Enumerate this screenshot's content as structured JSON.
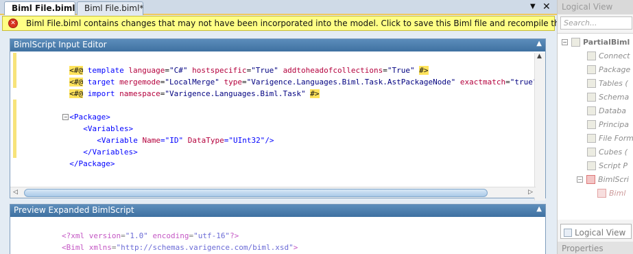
{
  "tabs": [
    {
      "label": "Biml File.biml",
      "active": true
    },
    {
      "label": "Biml File.biml*",
      "active": false
    }
  ],
  "tab_dropdown_icon": "▼",
  "tab_close_icon": "✕",
  "warning": {
    "icon": "error-icon",
    "icon_glyph": "✕",
    "text": "Biml File.biml contains changes that may not have been incorporated into the model. Click to save this Biml file and recompile the BimlScript."
  },
  "editor": {
    "title": "BimlScript Input Editor",
    "collapse_icon": "▲",
    "lines": [
      [
        "<#@",
        " ",
        "template",
        " ",
        "language",
        "=",
        "\"C#\"",
        " ",
        "hostspecific",
        "=",
        "\"True\"",
        " ",
        "addtoheadofcollections",
        "=",
        "\"True\"",
        " ",
        "#>"
      ],
      [
        "<#@",
        " ",
        "target",
        " ",
        "mergemode",
        "=",
        "\"LocalMerge\"",
        " ",
        "type",
        "=",
        "\"Varigence.Languages.Biml.Task.AstPackageNode\"",
        " ",
        "exactmatch",
        "=",
        "\"true\"",
        " ",
        "#>"
      ],
      [
        "<#@",
        " ",
        "import",
        " ",
        "namespace",
        "=",
        "\"Varigence.Languages.Biml.Task\"",
        " ",
        "#>"
      ],
      [],
      [
        "<Package>"
      ],
      [
        "<Variables>"
      ],
      [
        "<Variable",
        " ",
        "Name",
        "=",
        "\"ID\"",
        " ",
        "DataType",
        "=",
        "\"UInt32\"",
        "/>"
      ],
      [
        "</Variables>"
      ],
      [
        "</Package>"
      ]
    ]
  },
  "preview": {
    "title": "Preview Expanded BimlScript",
    "collapse_icon": "▲",
    "line1": {
      "open": "<?xml",
      "attr1": " version",
      "eq1": "=",
      "val1": "\"1.0\"",
      "attr2": " encoding",
      "eq2": "=",
      "val2": "\"utf-16\"",
      "close": "?>"
    },
    "line2": {
      "open": "<Biml",
      "attr": " xmlns",
      "eq": "=",
      "val": "\"http://schemas.varigence.com/biml.xsd\"",
      "close": ">"
    }
  },
  "logical_view": {
    "title": "Logical View",
    "search_placeholder": "Search...",
    "tree": [
      {
        "label": "PartialBiml",
        "icon": "project-icon",
        "level": 0
      },
      {
        "label": "Connect",
        "icon": "connection-icon",
        "level": 1
      },
      {
        "label": "Package",
        "icon": "package-folder-icon",
        "level": 1
      },
      {
        "label": "Tables (",
        "icon": "table-icon",
        "level": 1
      },
      {
        "label": "Schema",
        "icon": "schema-icon",
        "level": 1
      },
      {
        "label": "Databa",
        "icon": "database-icon",
        "level": 1
      },
      {
        "label": "Principa",
        "icon": "principal-icon",
        "level": 1
      },
      {
        "label": "File Form",
        "icon": "file-format-icon",
        "level": 1
      },
      {
        "label": "Cubes (",
        "icon": "cube-icon",
        "level": 1
      },
      {
        "label": "Script P",
        "icon": "script-icon",
        "level": 1
      },
      {
        "label": "BimlScri",
        "icon": "bimlscript-icon",
        "level": 1
      },
      {
        "label": "Biml",
        "icon": "biml-file-icon",
        "level": 2
      }
    ],
    "tab_label": "Logical View",
    "properties_label": "Properties"
  }
}
